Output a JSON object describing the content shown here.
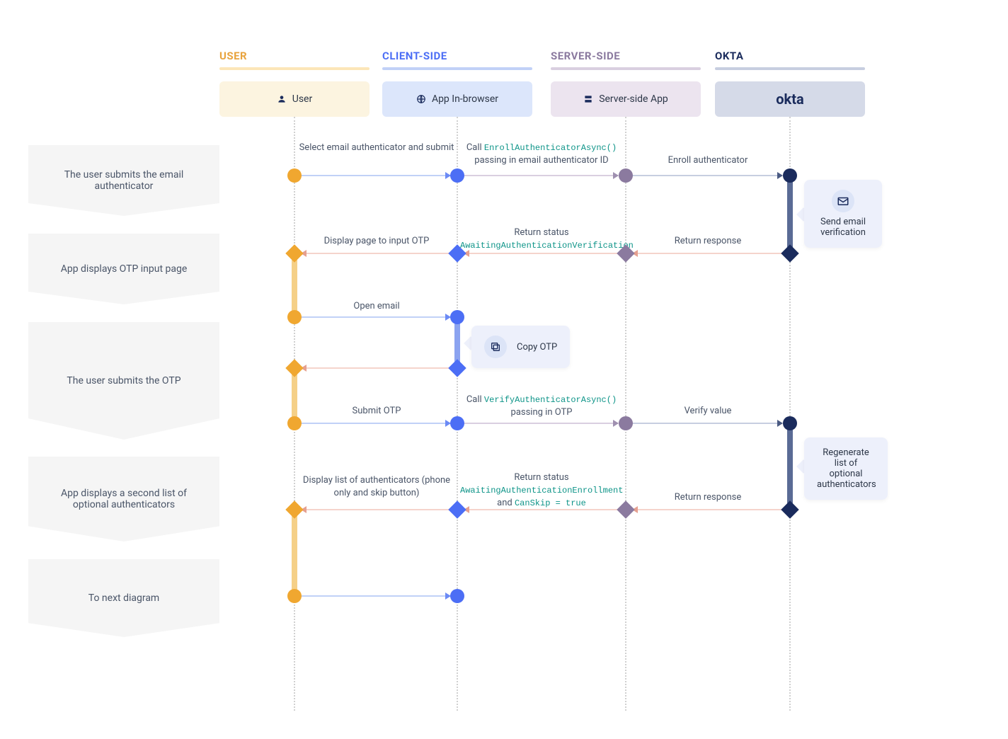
{
  "columns": {
    "user": {
      "header": "USER",
      "lane": "User"
    },
    "client": {
      "header": "CLIENT-SIDE",
      "lane": "App In-browser"
    },
    "server": {
      "header": "SERVER-SIDE",
      "lane": "Server-side App"
    },
    "okta": {
      "header": "OKTA",
      "lane": "okta"
    }
  },
  "steps": {
    "s1": "The user submits the email authenticator",
    "s2": "App displays OTP input page",
    "s3": "The user submits the OTP",
    "s4": "App displays a second list of optional authenticators",
    "s5": "To next diagram"
  },
  "arrows": {
    "a1": "Select email authenticator and submit",
    "a2_pre": "Call ",
    "a2_code": "EnrollAuthenticatorAsync()",
    "a2_post": "passing in email authenticator ID",
    "a3": "Enroll authenticator",
    "a4": "Return response",
    "a5_pre": "Return status",
    "a5_code": "AwaitingAuthenticationVerification",
    "a6": "Display page to input OTP",
    "a7": "Open email",
    "a8": "Submit OTP",
    "a9_pre": "Call ",
    "a9_code": "VerifyAuthenticatorAsync()",
    "a9_post": "passing in OTP",
    "a10": "Verify value",
    "a11": "Return response",
    "a12_pre": "Return status",
    "a12_code": "AwaitingAuthenticationEnrollment",
    "a12_mid": " and ",
    "a12_code2": "CanSkip = true",
    "a13": "Display list of authenticators (phone only and skip button)"
  },
  "callouts": {
    "c1": "Send email verification",
    "c2": "Copy OTP",
    "c3": "Regenerate list of optional authenticators"
  },
  "colors": {
    "user": "#f0a730",
    "client": "#4c6ef5",
    "server": "#8b7a9f",
    "okta": "#1a2b5c",
    "teal": "#0d9488"
  }
}
